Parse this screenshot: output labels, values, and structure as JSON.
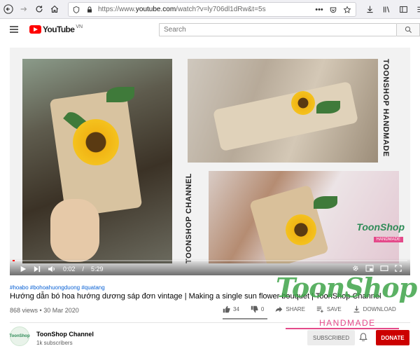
{
  "browser": {
    "url_prefix": "https://www.",
    "url_domain": "youtube.com",
    "url_path": "/watch?v=ly706dl1dRw&t=5s",
    "more_glyph": "•••"
  },
  "header": {
    "logo_text": "YouTube",
    "logo_region": "VN",
    "search_placeholder": "Search"
  },
  "player": {
    "vertical_text_1": "TOONSHOP HANDMADE",
    "vertical_text_2": "TOONSHOP CHANNEL",
    "watermark": "ToonShop",
    "watermark_sub": "HANDMADE",
    "current_time": "0:02",
    "duration": "5:29",
    "time_separator": " / ",
    "progress_fraction": 0.006
  },
  "video": {
    "hashtags": "#hoabo #bohoahuongduong #quatang",
    "title": "Hướng dẫn bó hoa hướng dương sáp đơn vintage | Making a single sun flower bouquet | ToonShop Channel",
    "views": "868 views",
    "date": "30 Mar 2020",
    "separator": " • "
  },
  "actions": {
    "likes": "34",
    "dislikes": "0",
    "share": "SHARE",
    "save": "SAVE",
    "download": "DOWNLOAD"
  },
  "channel": {
    "name": "ToonShop Channel",
    "subscribers": "1k subscribers",
    "avatar_text": "ToonShop",
    "subscribed_label": "SUBSCRIBED",
    "donate_label": "DONATE"
  },
  "overlay": {
    "brand": "ToonShop",
    "brand_sub": "HANDMADE"
  },
  "colors": {
    "youtube_red": "#ff0000",
    "link_blue": "#065fd4",
    "donate_red": "#cc0000",
    "brand_green": "#3fa44a",
    "brand_pink": "#e44a8a"
  }
}
